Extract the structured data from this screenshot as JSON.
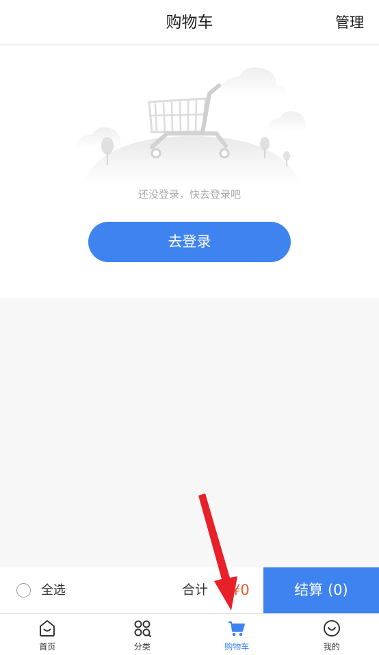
{
  "header": {
    "title": "购物车",
    "manage_label": "管理"
  },
  "empty_state": {
    "illustration": "empty-shopping-cart",
    "tip": "还没登录，快去登录吧",
    "login_button": "去登录"
  },
  "checkout": {
    "select_all_label": "全选",
    "total_label": "合计",
    "total_price": "¥0",
    "settle_button": "结算 (0)"
  },
  "tabbar": {
    "active": "cart",
    "items": [
      {
        "id": "home",
        "label": "首页",
        "icon": "home-icon"
      },
      {
        "id": "category",
        "label": "分类",
        "icon": "category-icon"
      },
      {
        "id": "cart",
        "label": "购物车",
        "icon": "cart-icon"
      },
      {
        "id": "me",
        "label": "我的",
        "icon": "smile-icon"
      }
    ]
  },
  "colors": {
    "accent": "#3f83f0",
    "price": "#ee5a2a",
    "annotation_arrow": "#e8202a"
  }
}
